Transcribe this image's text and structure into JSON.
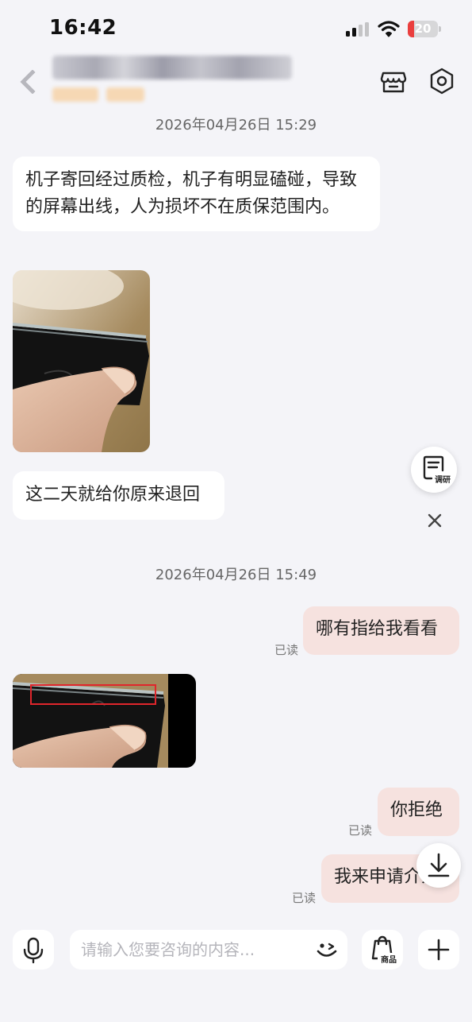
{
  "status_bar": {
    "time": "16:42",
    "battery_level": "20",
    "battery_fraction": 0.2,
    "battery_color": "#ea3e3e"
  },
  "header": {
    "title": "",
    "subtitle": "",
    "icons": [
      "back-chevron-icon",
      "shop-icon",
      "settings-hexagon-icon"
    ]
  },
  "messages": [
    {
      "type": "timestamp",
      "text": "2026年04月26日 15:29"
    },
    {
      "type": "incoming_text",
      "text": "机子寄回经过质检，机子有明显磕碰，导致的屏幕出线，人为损坏不在质保范围内。"
    },
    {
      "type": "incoming_image"
    },
    {
      "type": "incoming_text",
      "text": "这二天就给你原来退回"
    },
    {
      "type": "timestamp",
      "text": "2026年04月26日 15:49"
    },
    {
      "type": "outgoing_text",
      "text": "哪有指给我看看",
      "status": "已读"
    },
    {
      "type": "incoming_image"
    },
    {
      "type": "outgoing_text",
      "text": "你拒绝",
      "status": "已读"
    },
    {
      "type": "outgoing_text",
      "text": "我来申请介入",
      "status": "已读"
    }
  ],
  "floating": {
    "survey_label": "调研",
    "close_icon": "close-icon",
    "scroll_down_icon": "arrow-down-icon"
  },
  "input_bar": {
    "placeholder": "请输入您要咨询的内容...",
    "product_label": "商品",
    "icons": [
      "microphone-icon",
      "emoji-icon",
      "product-bag-icon",
      "plus-icon"
    ]
  },
  "colors": {
    "background": "#f4f4f8",
    "incoming_bubble": "#ffffff",
    "outgoing_bubble": "#f6e2df",
    "annotation_box": "#e0262c"
  }
}
